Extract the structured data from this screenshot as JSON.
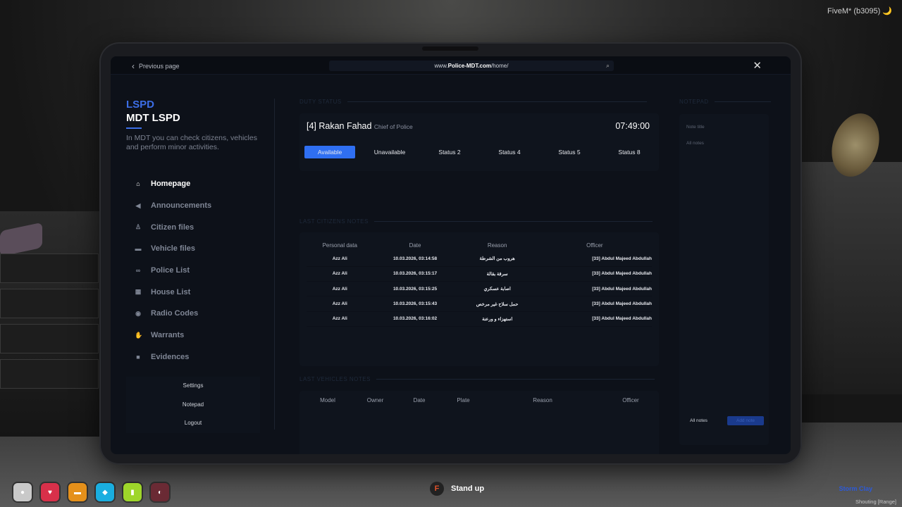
{
  "fivem_label": "FiveM* (b3095) 🌙",
  "topbar": {
    "prev_label": "Previous page",
    "url_prefix": "www.",
    "url_domain": "Police-MDT.com",
    "url_path": "/home/"
  },
  "brand": {
    "title": "LSPD",
    "name": "MDT LSPD",
    "subtitle": "In MDT you can check citizens, vehicles and perform minor activities."
  },
  "nav": [
    {
      "label": "Homepage",
      "icon": "home-icon",
      "glyph": "⌂"
    },
    {
      "label": "Announcements",
      "icon": "megaphone-icon",
      "glyph": "◀"
    },
    {
      "label": "Citizen files",
      "icon": "person-icon",
      "glyph": "♙"
    },
    {
      "label": "Vehicle files",
      "icon": "car-icon",
      "glyph": "▬"
    },
    {
      "label": "Police List",
      "icon": "glasses-icon",
      "glyph": "∞"
    },
    {
      "label": "House List",
      "icon": "building-icon",
      "glyph": "▦"
    },
    {
      "label": "Radio Codes",
      "icon": "radio-icon",
      "glyph": "◉"
    },
    {
      "label": "Warrants",
      "icon": "hand-icon",
      "glyph": "✋"
    },
    {
      "label": "Evidences",
      "icon": "camera-icon",
      "glyph": "■"
    }
  ],
  "bottom_links": [
    "Settings",
    "Notepad",
    "Logout"
  ],
  "sections": {
    "duty": "DUTY STATUS",
    "citizens": "LAST CITIZENS NOTES",
    "vehicles": "LAST VEHICLES NOTES",
    "notes": "NOTEPAD"
  },
  "duty": {
    "name": "[4] Rakan Fahad",
    "rank": "Chief of Police",
    "time": "07:49:00",
    "statuses": [
      "Available",
      "Unavailable",
      "Status 2",
      "Status 4",
      "Status 5",
      "Status 8"
    ]
  },
  "citizen_notes": {
    "columns": [
      "Personal data",
      "Date",
      "Reason",
      "Officer"
    ],
    "rows": [
      [
        "Azz Ali",
        "10.03.2026, 03:14:58",
        "هروب من الشرطة",
        "[33] Abdul Majeed Abdullah"
      ],
      [
        "Azz Ali",
        "10.03.2026, 03:15:17",
        "سرقة بقالة",
        "[33] Abdul Majeed Abdullah"
      ],
      [
        "Azz Ali",
        "10.03.2026, 03:15:25",
        "اصابة عسكري",
        "[33] Abdul Majeed Abdullah"
      ],
      [
        "Azz Ali",
        "10.03.2026, 03:15:43",
        "حمل سلاح غير مرخص",
        "[33] Abdul Majeed Abdullah"
      ],
      [
        "Azz Ali",
        "10.03.2026, 03:16:02",
        "استهزاء و ورعنة",
        "[33] Abdul Majeed Abdullah"
      ]
    ]
  },
  "vehicle_notes": {
    "columns": [
      "Model",
      "Owner",
      "Date",
      "Plate",
      "Reason",
      "Officer"
    ]
  },
  "notepad": {
    "title_placeholder": "Note title",
    "body_placeholder": "All notes",
    "all_notes": "All notes",
    "add_note": "Add note"
  },
  "hud": {
    "stand_key": "F",
    "stand_label": "Stand up",
    "street": "Storm Clay",
    "voice": "Shouting [Range]"
  },
  "colors": {
    "accent": "#2f6ff2",
    "brand": "#3c6ee6",
    "background": "#0d1119"
  }
}
